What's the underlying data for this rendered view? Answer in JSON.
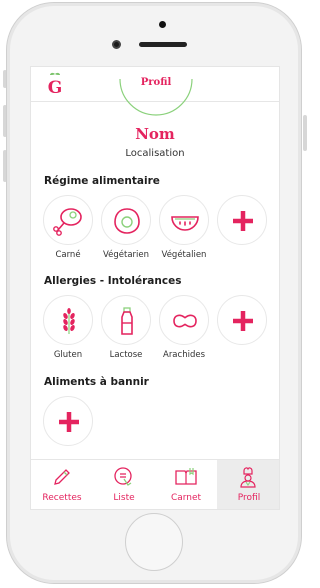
{
  "header": {
    "title": "Profil",
    "logo_text": "G"
  },
  "profile": {
    "name": "Nom",
    "location": "Localisation"
  },
  "sections": {
    "diet": {
      "title": "Régime alimentaire",
      "items": [
        {
          "icon": "meat-icon",
          "label": "Carné"
        },
        {
          "icon": "egg-icon",
          "label": "Végétarien"
        },
        {
          "icon": "watermelon-icon",
          "label": "Végétalien"
        },
        {
          "icon": "plus-icon",
          "label": ""
        }
      ]
    },
    "allergies": {
      "title": "Allergies - Intolérances",
      "items": [
        {
          "icon": "wheat-icon",
          "label": "Gluten"
        },
        {
          "icon": "milk-bottle-icon",
          "label": "Lactose"
        },
        {
          "icon": "peanut-icon",
          "label": "Arachides"
        },
        {
          "icon": "plus-icon",
          "label": ""
        }
      ]
    },
    "banned": {
      "title": "Aliments à bannir",
      "items": [
        {
          "icon": "plus-icon",
          "label": ""
        }
      ]
    }
  },
  "tabs": [
    {
      "icon": "pencil-icon",
      "label": "Recettes",
      "active": false
    },
    {
      "icon": "list-icon",
      "label": "Liste",
      "active": false
    },
    {
      "icon": "book-icon",
      "label": "Carnet",
      "active": false
    },
    {
      "icon": "chef-icon",
      "label": "Profil",
      "active": true
    }
  ],
  "colors": {
    "accent": "#e4245f",
    "green": "#8bd17c",
    "tab_active_bg": "#ececec"
  }
}
